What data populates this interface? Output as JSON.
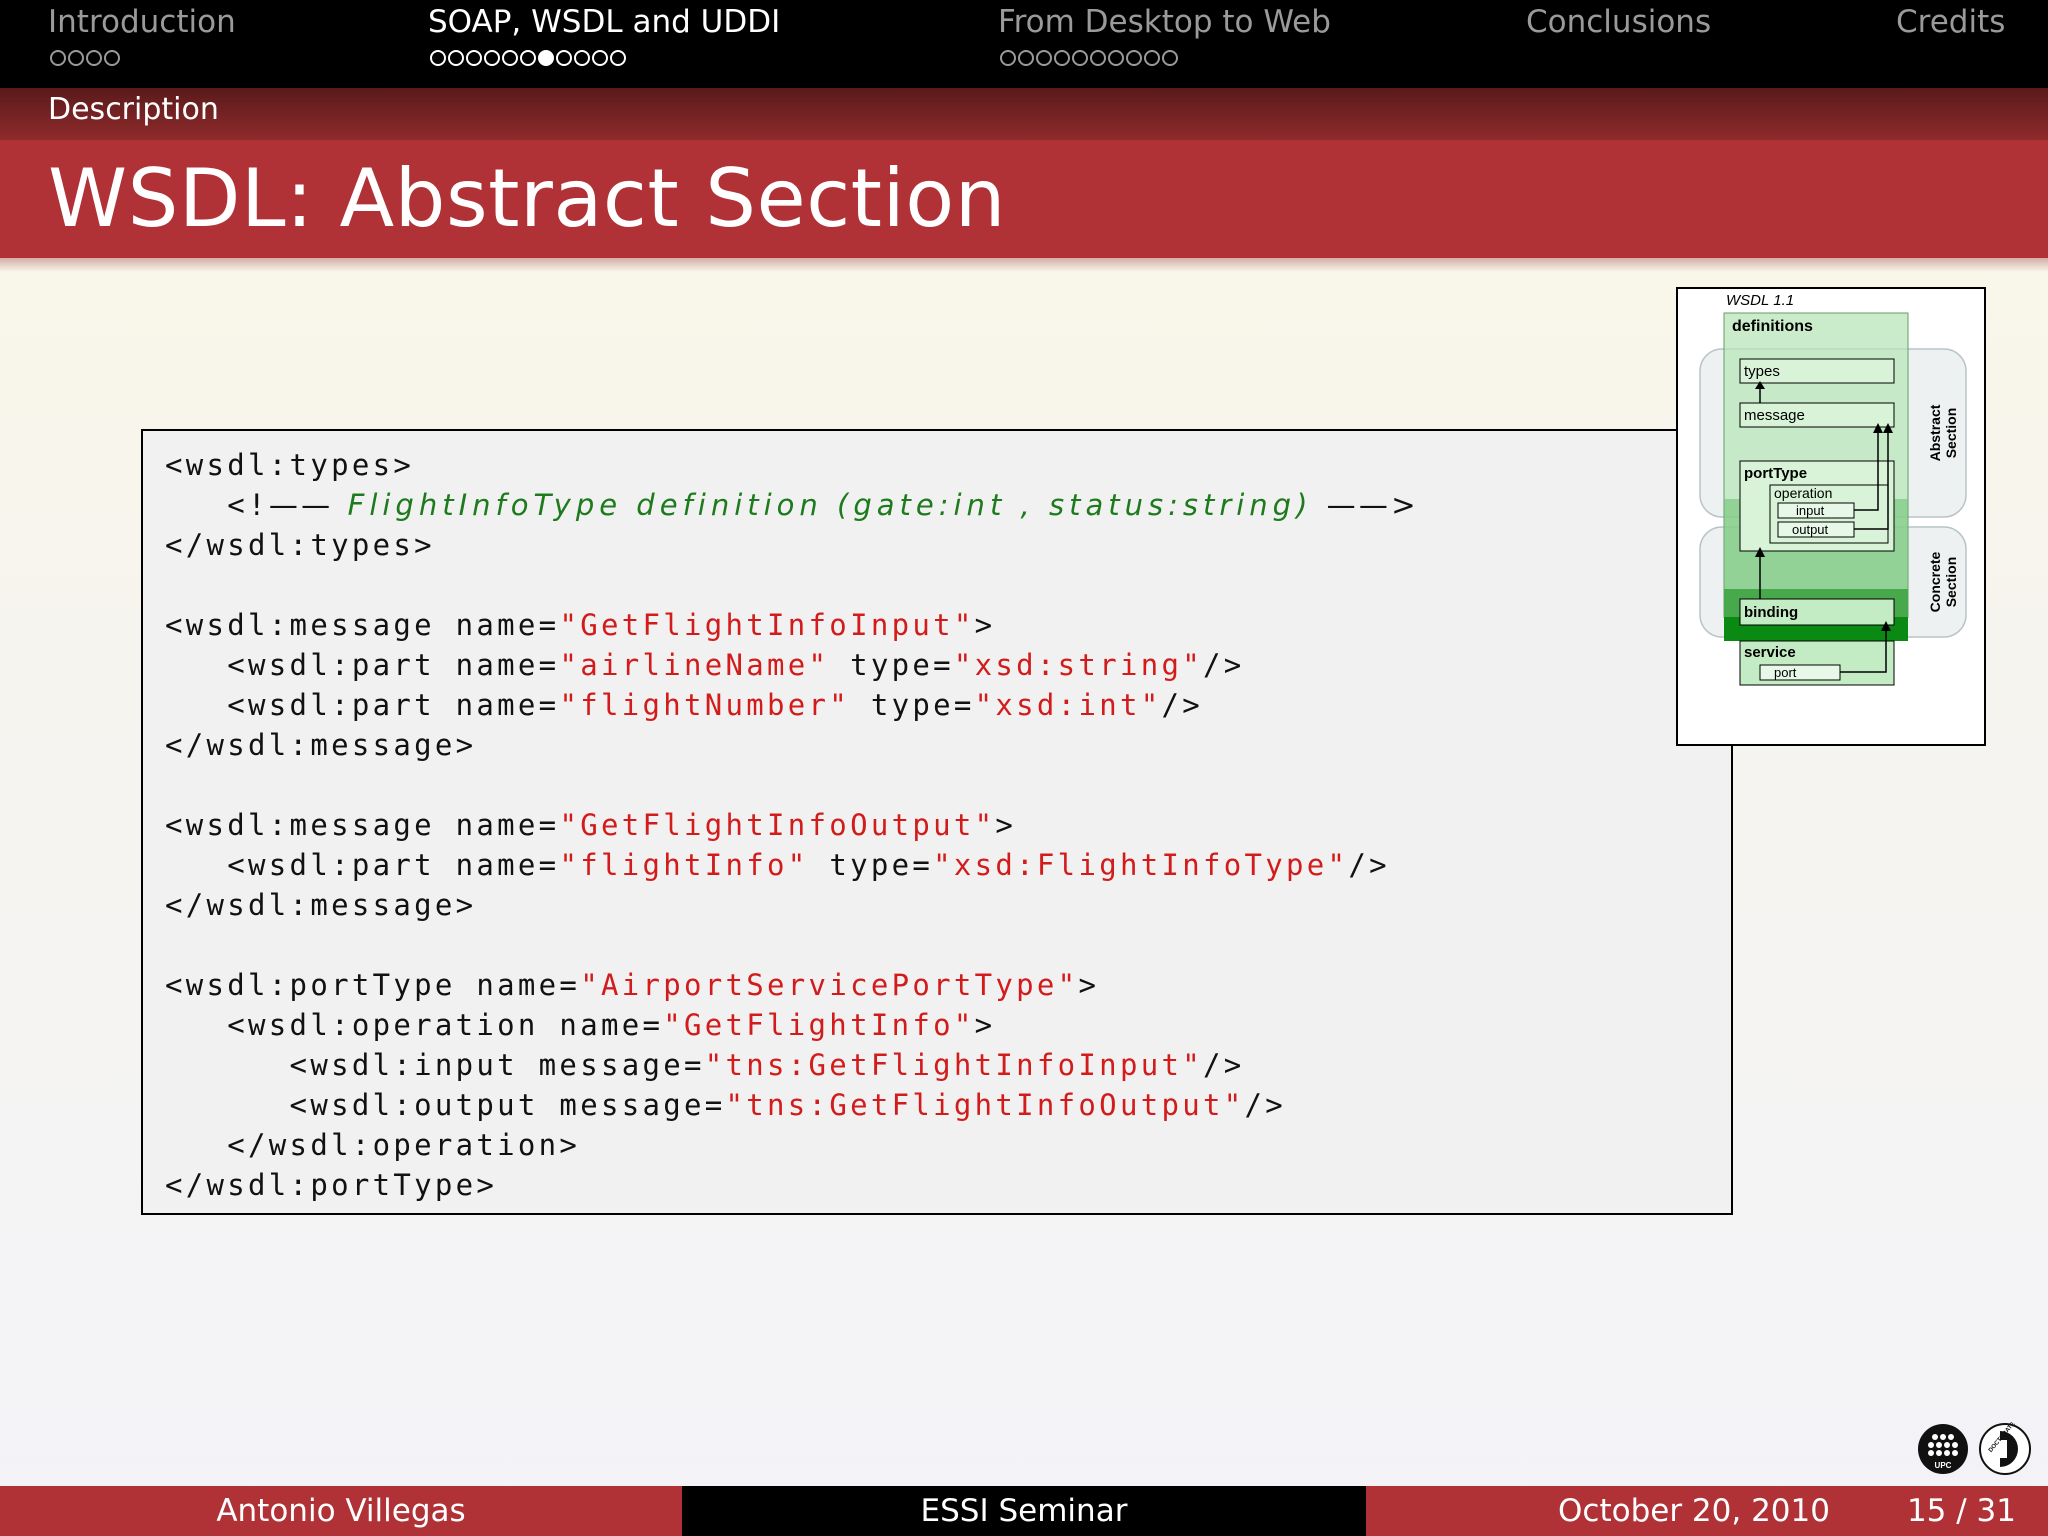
{
  "nav": {
    "sections": [
      {
        "title": "Introduction",
        "dots": 4,
        "filled": [],
        "active": false
      },
      {
        "title": "SOAP, WSDL and UDDI",
        "dots": 11,
        "filled": [
          6
        ],
        "active": true
      },
      {
        "title": "From Desktop to Web",
        "dots": 10,
        "filled": [],
        "active": false
      },
      {
        "title": "Conclusions",
        "dots": 0,
        "filled": [],
        "active": false
      },
      {
        "title": "Credits",
        "dots": 0,
        "filled": [],
        "active": false
      }
    ]
  },
  "header": {
    "subsection": "Description",
    "title": "WSDL: Abstract Section"
  },
  "code": {
    "lines": [
      [
        {
          "t": "<wsdl:types>",
          "k": "tag"
        }
      ],
      [
        {
          "t": "   <!",
          "k": "tag"
        },
        {
          "t": "——",
          "k": "dash"
        },
        {
          "t": " FlightInfoType definition (gate:int , status:string) ",
          "k": "cmt"
        },
        {
          "t": "——>",
          "k": "dash"
        }
      ],
      [
        {
          "t": "</wsdl:types>",
          "k": "tag"
        }
      ],
      [],
      [
        {
          "t": "<wsdl:message name=",
          "k": "tag"
        },
        {
          "t": "\"GetFlightInfoInput\"",
          "k": "str"
        },
        {
          "t": ">",
          "k": "tag"
        }
      ],
      [
        {
          "t": "   <wsdl:part name=",
          "k": "tag"
        },
        {
          "t": "\"airlineName\"",
          "k": "str"
        },
        {
          "t": " type=",
          "k": "tag"
        },
        {
          "t": "\"xsd:string\"",
          "k": "str"
        },
        {
          "t": "/>",
          "k": "tag"
        }
      ],
      [
        {
          "t": "   <wsdl:part name=",
          "k": "tag"
        },
        {
          "t": "\"flightNumber\"",
          "k": "str"
        },
        {
          "t": " type=",
          "k": "tag"
        },
        {
          "t": "\"xsd:int\"",
          "k": "str"
        },
        {
          "t": "/>",
          "k": "tag"
        }
      ],
      [
        {
          "t": "</wsdl:message>",
          "k": "tag"
        }
      ],
      [],
      [
        {
          "t": "<wsdl:message name=",
          "k": "tag"
        },
        {
          "t": "\"GetFlightInfoOutput\"",
          "k": "str"
        },
        {
          "t": ">",
          "k": "tag"
        }
      ],
      [
        {
          "t": "   <wsdl:part name=",
          "k": "tag"
        },
        {
          "t": "\"flightInfo\"",
          "k": "str"
        },
        {
          "t": " type=",
          "k": "tag"
        },
        {
          "t": "\"xsd:FlightInfoType\"",
          "k": "str"
        },
        {
          "t": "/>",
          "k": "tag"
        }
      ],
      [
        {
          "t": "</wsdl:message>",
          "k": "tag"
        }
      ],
      [],
      [
        {
          "t": "<wsdl:portType name=",
          "k": "tag"
        },
        {
          "t": "\"AirportServicePortType\"",
          "k": "str"
        },
        {
          "t": ">",
          "k": "tag"
        }
      ],
      [
        {
          "t": "   <wsdl:operation name=",
          "k": "tag"
        },
        {
          "t": "\"GetFlightInfo\"",
          "k": "str"
        },
        {
          "t": ">",
          "k": "tag"
        }
      ],
      [
        {
          "t": "      <wsdl:input message=",
          "k": "tag"
        },
        {
          "t": "\"tns:GetFlightInfoInput\"",
          "k": "str"
        },
        {
          "t": "/>",
          "k": "tag"
        }
      ],
      [
        {
          "t": "      <wsdl:output message=",
          "k": "tag"
        },
        {
          "t": "\"tns:GetFlightInfoOutput\"",
          "k": "str"
        },
        {
          "t": "/>",
          "k": "tag"
        }
      ],
      [
        {
          "t": "   </wsdl:operation>",
          "k": "tag"
        }
      ],
      [
        {
          "t": "</wsdl:portType>",
          "k": "tag"
        }
      ]
    ]
  },
  "diagram": {
    "heading": "WSDL 1.1",
    "definitions": "definitions",
    "types": "types",
    "message": "message",
    "portType": "portType",
    "operation": "operation",
    "input": "input",
    "output": "output",
    "binding": "binding",
    "service": "service",
    "port": "port",
    "abstract_label_1": "Abstract",
    "abstract_label_2": "Section",
    "concrete_label_1": "Concrete",
    "concrete_label_2": "Section"
  },
  "logos": {
    "upc": "UPC",
    "doctorate": "DOCTORATE"
  },
  "footer": {
    "author": "Antonio Villegas",
    "event": "ESSI Seminar",
    "date": "October 20, 2010",
    "page": "15 / 31"
  },
  "colors": {
    "accent_red": "#b03237",
    "code_string": "#d21c1c",
    "code_comment": "#1d7a1d",
    "diagram_green": "#0a8a12"
  }
}
